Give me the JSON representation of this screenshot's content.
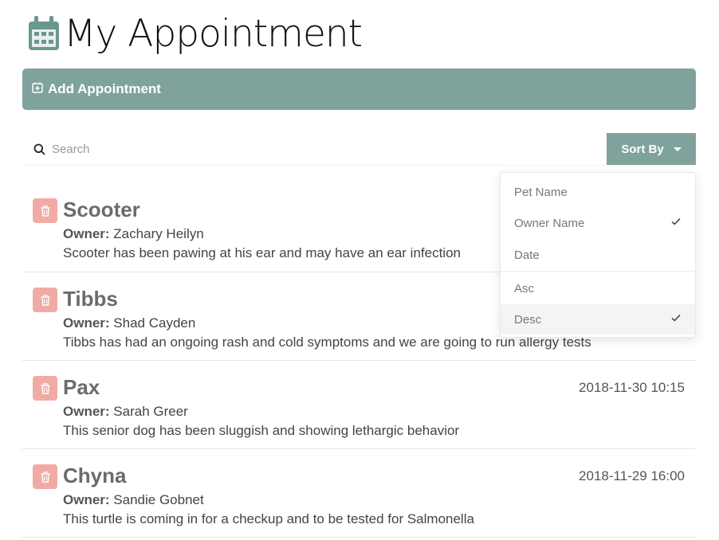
{
  "header": {
    "title": "My Appointment",
    "icon": "calendar-icon",
    "icon_color": "#6a9790"
  },
  "add_bar": {
    "label": "Add Appointment",
    "icon": "plus-square-icon",
    "color": "#7fa39c"
  },
  "search": {
    "placeholder": "Search",
    "value": "",
    "icon": "search-icon"
  },
  "sort": {
    "button_label": "Sort By",
    "options": [
      {
        "label": "Pet Name",
        "checked": false
      },
      {
        "label": "Owner Name",
        "checked": true
      },
      {
        "label": "Date",
        "checked": false
      }
    ],
    "order": [
      {
        "label": "Asc",
        "checked": false
      },
      {
        "label": "Desc",
        "checked": true
      }
    ]
  },
  "owner_label": "Owner:",
  "appointments": [
    {
      "pet": "Scooter",
      "owner": "Zachary Heilyn",
      "notes": "Scooter has been pawing at his ear and may have an ear infection",
      "date": ""
    },
    {
      "pet": "Tibbs",
      "owner": "Shad Cayden",
      "notes": "Tibbs has had an ongoing rash and cold symptoms and we are going to run allergy tests",
      "date": ""
    },
    {
      "pet": "Pax",
      "owner": "Sarah Greer",
      "notes": "This senior dog has been sluggish and showing lethargic behavior",
      "date": "2018-11-30 10:15"
    },
    {
      "pet": "Chyna",
      "owner": "Sandie Gobnet",
      "notes": "This turtle is coming in for a checkup and to be tested for Salmonella",
      "date": "2018-11-29 16:00"
    }
  ],
  "colors": {
    "accent": "#7fa39c",
    "delete": "#f1aba5"
  }
}
